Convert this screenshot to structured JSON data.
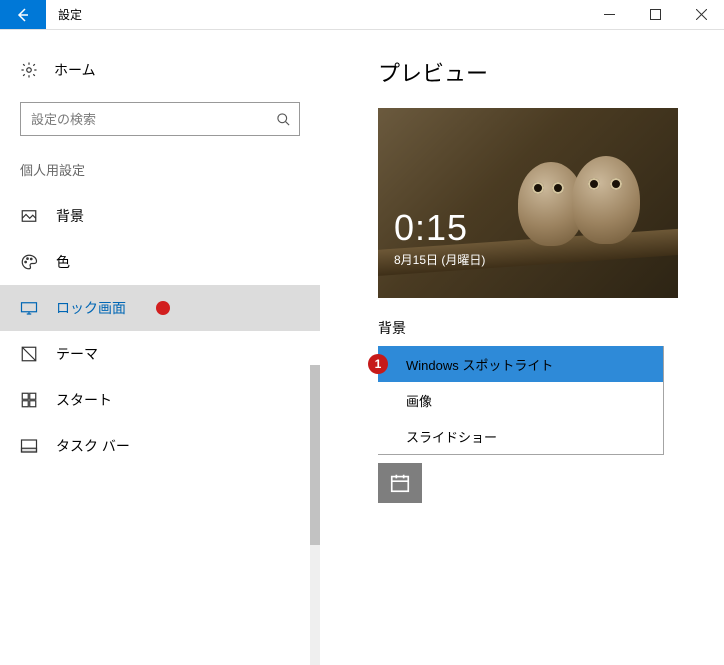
{
  "window": {
    "title": "設定"
  },
  "sidebar": {
    "home_label": "ホーム",
    "search_placeholder": "設定の検索",
    "category_label": "個人用設定",
    "items": [
      {
        "label": "背景",
        "icon": "picture"
      },
      {
        "label": "色",
        "icon": "palette"
      },
      {
        "label": "ロック画面",
        "icon": "lockscreen",
        "selected": true,
        "dot": true
      },
      {
        "label": "テーマ",
        "icon": "theme"
      },
      {
        "label": "スタート",
        "icon": "start"
      },
      {
        "label": "タスク バー",
        "icon": "taskbar"
      }
    ]
  },
  "detail": {
    "heading": "プレビュー",
    "preview": {
      "time": "0:15",
      "date": "8月15日 (月曜日)"
    },
    "background_label": "背景",
    "dropdown": {
      "options": [
        "Windows スポットライト",
        "画像",
        "スライドショー"
      ],
      "selected_index": 0
    },
    "annotation_badge": "1"
  }
}
